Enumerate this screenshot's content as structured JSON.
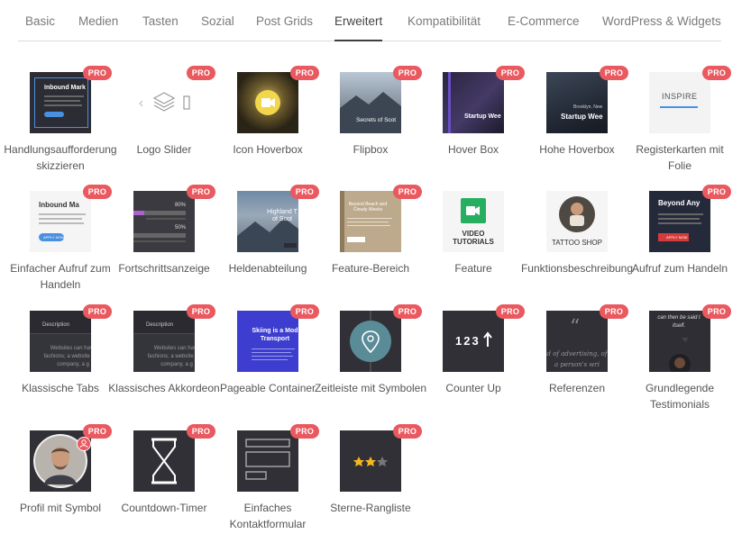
{
  "tabs": [
    {
      "label": "Basic",
      "active": false
    },
    {
      "label": "Medien",
      "active": false
    },
    {
      "label": "Tasten",
      "active": false
    },
    {
      "label": "Sozial",
      "active": false
    },
    {
      "label": "Post Grids",
      "active": false
    },
    {
      "label": "Erweitert",
      "active": true
    },
    {
      "label": "Kompatibilität",
      "active": false
    },
    {
      "label": "E-Commerce",
      "active": false
    },
    {
      "label": "WordPress & Widgets",
      "active": false
    }
  ],
  "badge_label": "PRO",
  "thumbs": {
    "inbound": "Inbound Mark",
    "secrets": "Secrets of Scot",
    "startup": "Startup Wee",
    "brooklyn": "Brooklyn, New",
    "inspire": "INSPIRE",
    "inbound2": "Inbound Ma",
    "apply": "APPLY NOW",
    "p80": "80%",
    "p50": "50%",
    "highland": "Highland T of Scot",
    "beyond_beach": "Beyond Beach and Cloudy Weeks",
    "video": "VIDEO TUTORIALS",
    "tattoo": "TATTOO SHOP",
    "beyond_any": "Beyond Any",
    "description": "Description",
    "websites": "Websites can have fashions; a website for a company, a g",
    "skiing": "Skiing is a Mod Transport",
    "counter": "123",
    "quote": "d of advertising, of a person's wri",
    "testimonial": "can then be said t itself."
  },
  "items": [
    {
      "label": "Handlungsaufforderung skizzieren",
      "icon": "cta-outline-thumb"
    },
    {
      "label": "Logo Slider",
      "icon": "logo-slider-thumb"
    },
    {
      "label": "Icon Hoverbox",
      "icon": "icon-hoverbox-thumb"
    },
    {
      "label": "Flipbox",
      "icon": "flipbox-thumb"
    },
    {
      "label": "Hover Box",
      "icon": "hover-box-thumb"
    },
    {
      "label": "Hohe Hoverbox",
      "icon": "tall-hoverbox-thumb"
    },
    {
      "label": "Registerkarten mit Folie",
      "icon": "slide-tabs-thumb"
    },
    {
      "label": "Einfacher Aufruf zum Handeln",
      "icon": "simple-cta-thumb"
    },
    {
      "label": "Fortschrittsanzeige",
      "icon": "progress-bar-thumb"
    },
    {
      "label": "Heldenabteilung",
      "icon": "hero-section-thumb"
    },
    {
      "label": "Feature-Bereich",
      "icon": "feature-section-thumb"
    },
    {
      "label": "Feature",
      "icon": "feature-thumb"
    },
    {
      "label": "Funktionsbeschreibung",
      "icon": "feature-description-thumb"
    },
    {
      "label": "Aufruf zum Handeln",
      "icon": "cta-thumb"
    },
    {
      "label": "Klassische Tabs",
      "icon": "classic-tabs-thumb"
    },
    {
      "label": "Klassisches Akkordeon",
      "icon": "classic-accordion-thumb"
    },
    {
      "label": "Pageable Container",
      "icon": "pageable-container-thumb"
    },
    {
      "label": "Zeitleiste mit Symbolen",
      "icon": "timeline-icons-thumb"
    },
    {
      "label": "Counter Up",
      "icon": "counter-up-thumb"
    },
    {
      "label": "Referenzen",
      "icon": "testimonials-thumb"
    },
    {
      "label": "Grundlegende Testimonials",
      "icon": "basic-testimonials-thumb"
    },
    {
      "label": "Profil mit Symbol",
      "icon": "profile-icon-thumb"
    },
    {
      "label": "Countdown-Timer",
      "icon": "countdown-timer-thumb"
    },
    {
      "label": "Einfaches Kontaktformular",
      "icon": "contact-form-thumb"
    },
    {
      "label": "Sterne-Rangliste",
      "icon": "star-rating-thumb"
    }
  ],
  "colors": {
    "badge": "#e9595f",
    "dark_thumb": "#2c2c34",
    "accent_blue": "#4a90e2",
    "feature_green": "#27ae60"
  }
}
